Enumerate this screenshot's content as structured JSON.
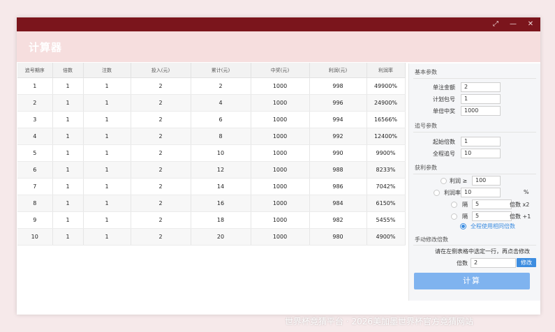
{
  "window": {
    "title": "计算器",
    "restore_glyph": "⤢",
    "min_glyph": "—",
    "close_glyph": "✕"
  },
  "table": {
    "headers": [
      "追号期序",
      "倍数",
      "注数",
      "投入(元)",
      "累计(元)",
      "中奖(元)",
      "利润(元)",
      "利润率"
    ],
    "rows": [
      [
        "1",
        "1",
        "1",
        "2",
        "2",
        "1000",
        "998",
        "49900%"
      ],
      [
        "2",
        "1",
        "1",
        "2",
        "4",
        "1000",
        "996",
        "24900%"
      ],
      [
        "3",
        "1",
        "1",
        "2",
        "6",
        "1000",
        "994",
        "16566%"
      ],
      [
        "4",
        "1",
        "1",
        "2",
        "8",
        "1000",
        "992",
        "12400%"
      ],
      [
        "5",
        "1",
        "1",
        "2",
        "10",
        "1000",
        "990",
        "9900%"
      ],
      [
        "6",
        "1",
        "1",
        "2",
        "12",
        "1000",
        "988",
        "8233%"
      ],
      [
        "7",
        "1",
        "1",
        "2",
        "14",
        "1000",
        "986",
        "7042%"
      ],
      [
        "8",
        "1",
        "1",
        "2",
        "16",
        "1000",
        "984",
        "6150%"
      ],
      [
        "9",
        "1",
        "1",
        "2",
        "18",
        "1000",
        "982",
        "5455%"
      ],
      [
        "10",
        "1",
        "1",
        "2",
        "20",
        "1000",
        "980",
        "4900%"
      ]
    ]
  },
  "basic": {
    "title": "基本参数",
    "unit_amount_label": "单注金额",
    "unit_amount": "2",
    "plan_bets_label": "计划包号",
    "plan_bets": "1",
    "single_prize_label": "单倍中奖",
    "single_prize": "1000"
  },
  "chase": {
    "title": "追号参数",
    "start_multiple_label": "起始倍数",
    "start_multiple": "1",
    "total_issues_label": "全程追号",
    "total_issues": "10"
  },
  "profit": {
    "title": "获利参数",
    "profit_ge_label": "利润 ≥",
    "profit_ge": "100",
    "rate_ge_label": "利润率 ≥",
    "rate_ge": "10",
    "rate_unit": "%",
    "every_label_1": "隔",
    "every_value_1": "5",
    "every_suffix_1": "倍数 x2",
    "every_label_2": "隔",
    "every_value_2": "5",
    "every_suffix_2": "倍数 +1",
    "same_multiple_label": "全程使用相同倍数"
  },
  "manual": {
    "title": "手动修改倍数",
    "hint": "请在左侧表格中选定一行，再点击修改",
    "multiple_label": "倍数",
    "multiple": "2",
    "modify_button": "修改"
  },
  "calc_button": "计算",
  "watermark": "世界杯竞猜平台 · 2026美加墨世界杯官方竞猜网站",
  "colors": {
    "titlebar": "#7b151c",
    "accent": "#3d8de0",
    "calc_button": "#7fb3ef"
  }
}
